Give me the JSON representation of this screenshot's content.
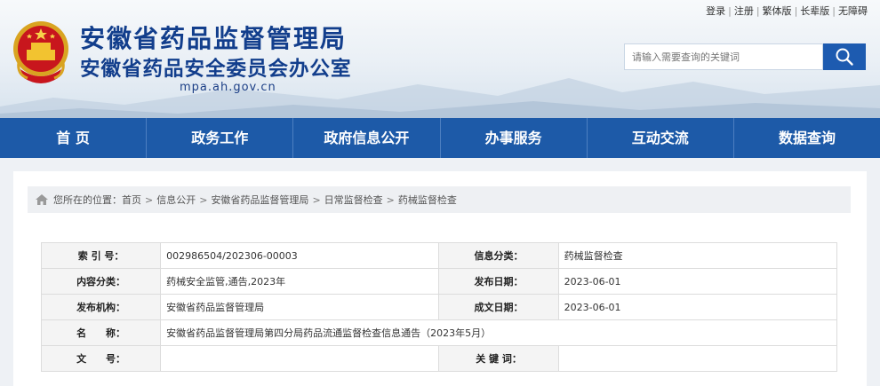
{
  "site": {
    "title": "安徽省药品监督管理局",
    "subtitle": "安徽省药品安全委员会办公室",
    "domain": "mpa.ah.gov.cn"
  },
  "toplinks": [
    "登录",
    "注册",
    "繁体版",
    "长辈版",
    "无障碍"
  ],
  "search": {
    "placeholder": "请输入需要查询的关键词"
  },
  "nav": [
    "首 页",
    "政务工作",
    "政府信息公开",
    "办事服务",
    "互动交流",
    "数据查询"
  ],
  "breadcrumb": {
    "prefix": "您所在的位置：",
    "items": [
      "首页",
      "信息公开",
      "安徽省药品监督管理局",
      "日常监督检查",
      "药械监督检查"
    ]
  },
  "meta": {
    "index_label": "索 引 号：",
    "index_value": "002986504/202306-00003",
    "category_label": "信息分类：",
    "category_value": "药械监督检查",
    "content_label": "内容分类：",
    "content_value": "药械安全监管,通告,2023年",
    "publish_date_label": "发布日期：",
    "publish_date_value": "2023-06-01",
    "org_label": "发布机构：",
    "org_value": "安徽省药品监督管理局",
    "created_date_label": "成文日期：",
    "created_date_value": "2023-06-01",
    "name_label": "名　　称：",
    "name_value": "安徽省药品监督管理局第四分局药品流通监督检查信息通告（2023年5月）",
    "docno_label": "文　　号：",
    "docno_value": "",
    "keywords_label": "关 键 词：",
    "keywords_value": ""
  },
  "colors": {
    "nav": "#1d5aa8",
    "title": "#123e8c",
    "search_button": "#1d5bb0"
  },
  "icons": {
    "search": "search-icon",
    "home": "home-icon",
    "emblem": "national-emblem"
  }
}
